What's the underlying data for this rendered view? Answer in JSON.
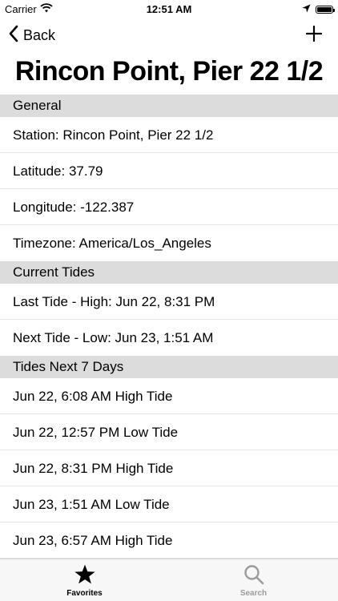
{
  "status_bar": {
    "carrier": "Carrier",
    "time": "12:51 AM"
  },
  "nav": {
    "back_label": "Back",
    "add_icon": "plus-icon"
  },
  "page_title": "Rincon Point, Pier 22 1/2",
  "sections": {
    "general": {
      "header": "General",
      "rows": [
        "Station: Rincon Point, Pier 22 1/2",
        "Latitude: 37.79",
        "Longitude: -122.387",
        "Timezone: America/Los_Angeles"
      ]
    },
    "current_tides": {
      "header": "Current Tides",
      "rows": [
        "Last Tide - High: Jun 22, 8:31 PM",
        "Next Tide - Low: Jun 23, 1:51 AM"
      ]
    },
    "next_7_days": {
      "header": "Tides Next 7 Days",
      "rows": [
        "Jun 22, 6:08 AM High Tide",
        "Jun 22, 12:57 PM Low Tide",
        "Jun 22, 8:31 PM High Tide",
        "Jun 23, 1:51 AM Low Tide",
        "Jun 23, 6:57 AM High Tide"
      ]
    }
  },
  "tab_bar": {
    "favorites_label": "Favorites",
    "search_label": "Search",
    "active_color": "#000000",
    "inactive_color": "#9b9b9b"
  }
}
